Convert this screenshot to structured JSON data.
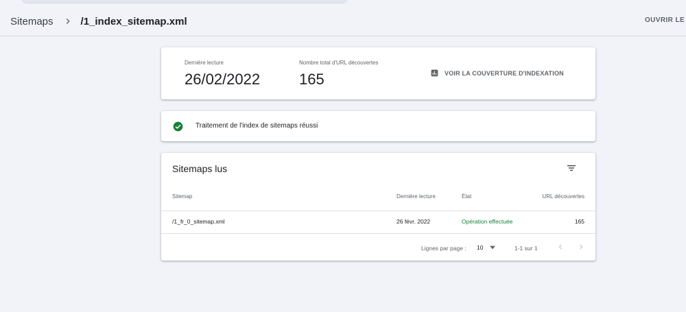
{
  "colors": {
    "background": "#f1f3f9",
    "card": "#ffffff",
    "success": "#188038",
    "text_secondary": "#5f6368"
  },
  "header": {
    "breadcrumb_root": "Sitemaps",
    "breadcrumb_current": "/1_index_sitemap.xml",
    "open_link_label": "OUVRIR LE SITEMAP"
  },
  "summary": {
    "last_read_label": "Dernière lecture",
    "last_read_value": "26/02/2022",
    "urls_label": "Nombre total d'URL découvertes",
    "urls_value": "165",
    "coverage_link_label": "VOIR LA COUVERTURE D'INDEXATION",
    "coverage_icon": "bar-chart-icon"
  },
  "status": {
    "icon": "check-circle-icon",
    "text": "Traitement de l'index de sitemaps réussi"
  },
  "table": {
    "title": "Sitemaps lus",
    "filter_icon": "filter-icon",
    "columns": [
      "Sitemap",
      "Dernière lecture",
      "État",
      "URL découvertes"
    ],
    "rows": [
      [
        "/1_fr_0_sitemap.xml",
        "26 févr. 2022",
        "Opération effectuée",
        "165"
      ]
    ],
    "pagination": {
      "rows_per_page_label": "Lignes par page :",
      "rows_per_page_value": "10",
      "range": "1-1 sur 1"
    }
  }
}
